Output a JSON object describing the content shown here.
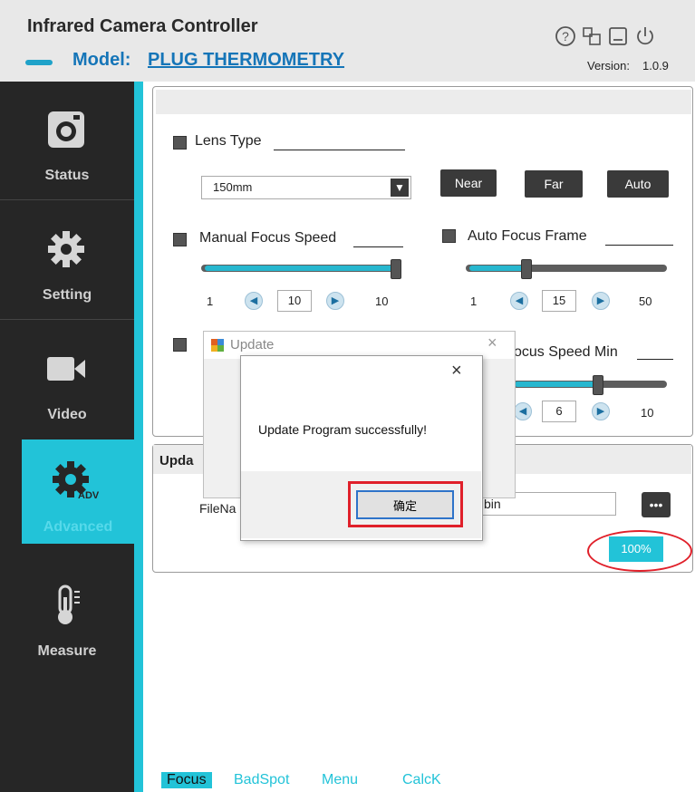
{
  "header": {
    "app_title": "Infrared Camera Controller",
    "model_label": "Model:",
    "model_value": "PLUG THERMOMETRY",
    "version_label": "Version:",
    "version_value": "1.0.9",
    "icons": [
      "help-icon",
      "tools-icon",
      "minimize-icon",
      "power-icon"
    ]
  },
  "sidebar": {
    "items": [
      {
        "label": "Status",
        "icon": "camera-icon"
      },
      {
        "label": "Setting",
        "icon": "gear-icon"
      },
      {
        "label": "Video",
        "icon": "video-icon"
      },
      {
        "label": "Advanced",
        "icon": "adv-gear-icon",
        "badge": "ADV"
      },
      {
        "label": "Measure",
        "icon": "thermometer-icon"
      }
    ],
    "accent_color": "#22c3d8"
  },
  "focus": {
    "lens_type_label": "Lens Type",
    "lens_select_value": "150mm",
    "near_label": "Near",
    "far_label": "Far",
    "auto_label": "Auto",
    "manual_speed_label": "Manual Focus Speed",
    "manual_min": "1",
    "manual_value": "10",
    "manual_max": "10",
    "manual_fraction": 1.0,
    "auto_frame_label": "Auto Focus Frame",
    "auto_frame_min": "1",
    "auto_frame_value": "15",
    "auto_frame_max": "50",
    "auto_frame_fraction": 0.29,
    "speed_min_label": "ocus Speed Min",
    "speed_min_value": "6",
    "speed_min_max": "10",
    "speed_min_fraction": 0.55
  },
  "update": {
    "title": "Upda",
    "filename_label": "FileNa",
    "file_value": "l.bin",
    "browse_label": "•••",
    "progress_text": "100%"
  },
  "bg_dialog": {
    "title": "Update",
    "close": "×"
  },
  "msgbox": {
    "message": "Update Program successfully!",
    "ok_label": "确定",
    "close": "×"
  },
  "tabs": [
    {
      "label": "Focus"
    },
    {
      "label": "BadSpot"
    },
    {
      "label": "Menu"
    },
    {
      "label": "CalcK"
    }
  ]
}
